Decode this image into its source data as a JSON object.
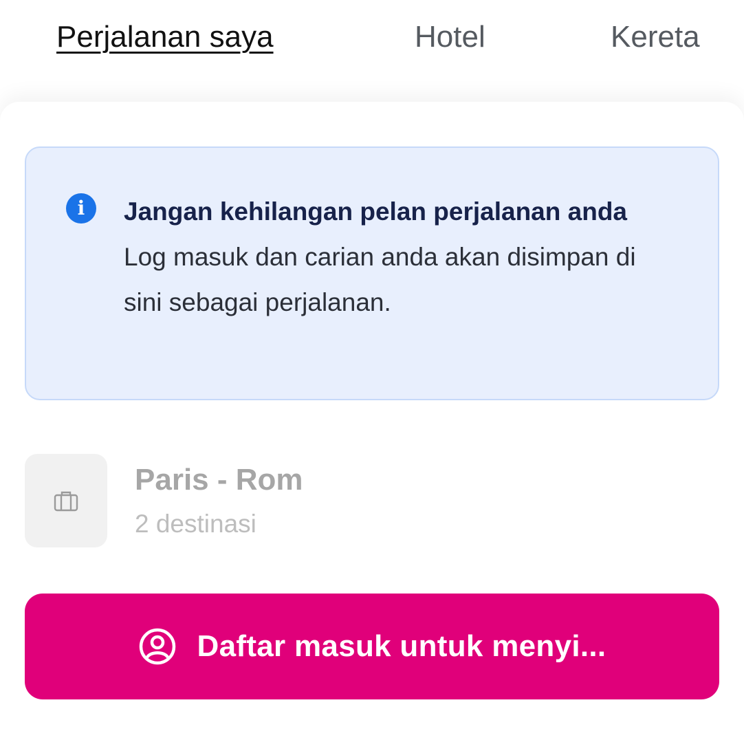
{
  "tabs": [
    {
      "label": "Perjalanan saya",
      "active": true
    },
    {
      "label": "Hotel",
      "active": false
    },
    {
      "label": "Kereta",
      "active": false
    }
  ],
  "info": {
    "icon": "info-icon",
    "title": "Jangan kehilangan pelan perjalanan anda",
    "body": "Log masuk dan carian anda akan disimpan di sini sebagai perjalanan."
  },
  "trip": {
    "icon": "briefcase-icon",
    "title": "Paris - Rom",
    "subtitle": "2 destinasi"
  },
  "signin": {
    "icon": "user-circle-icon",
    "label": "Daftar masuk untuk menyi..."
  },
  "colors": {
    "accent": "#e0007a",
    "info_bg": "#e8effd",
    "info_icon": "#1a73e8"
  }
}
